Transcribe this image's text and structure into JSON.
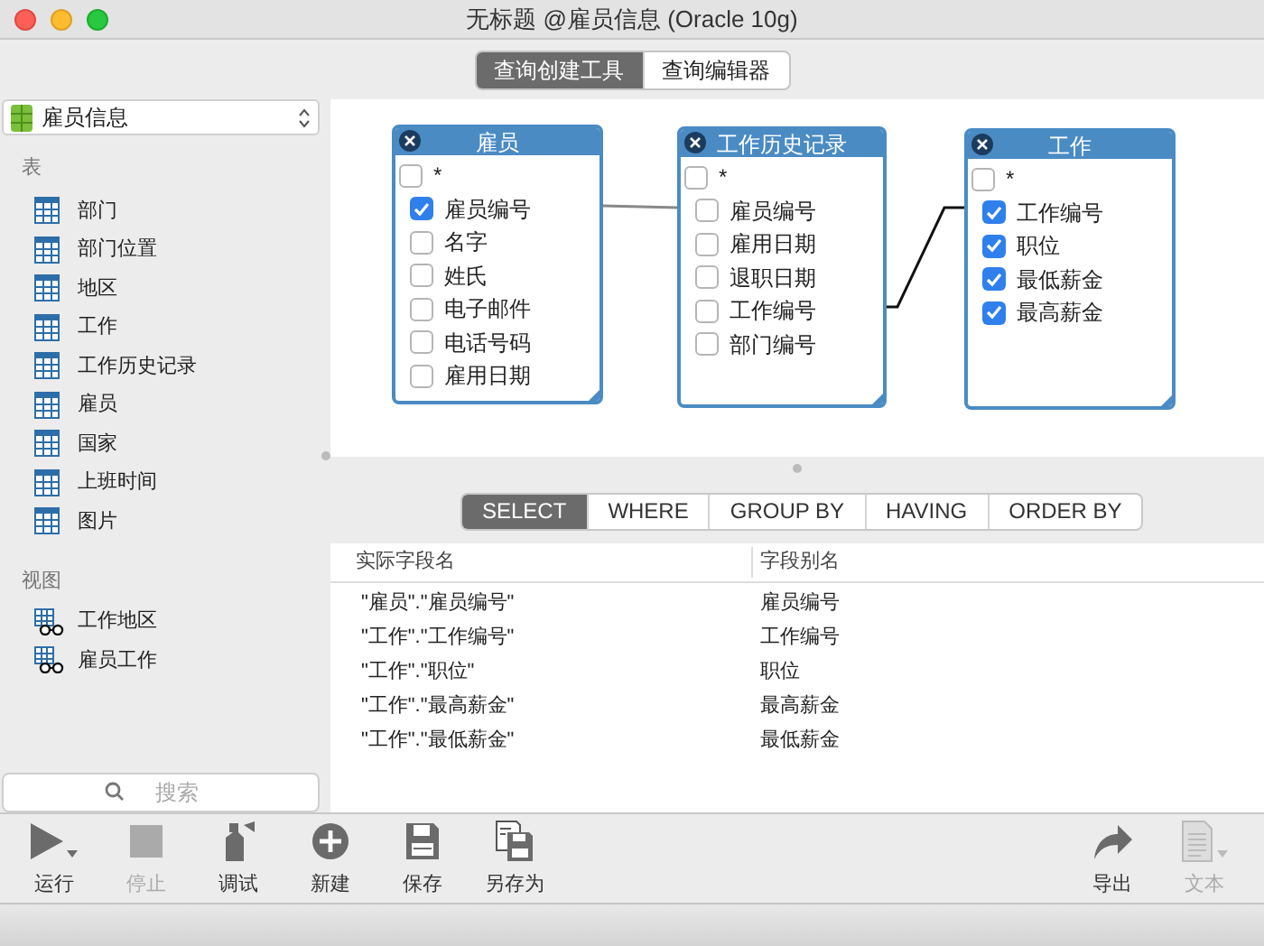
{
  "window": {
    "title": "无标题 @雇员信息 (Oracle 10g)"
  },
  "mode_tabs": [
    {
      "label": "查询创建工具",
      "selected": true
    },
    {
      "label": "查询编辑器",
      "selected": false
    }
  ],
  "sidebar": {
    "database": "雇员信息",
    "sections": [
      {
        "title": "表",
        "items": [
          {
            "label": "部门",
            "kind": "table"
          },
          {
            "label": "部门位置",
            "kind": "table"
          },
          {
            "label": "地区",
            "kind": "table"
          },
          {
            "label": "工作",
            "kind": "table"
          },
          {
            "label": "工作历史记录",
            "kind": "table"
          },
          {
            "label": "雇员",
            "kind": "table"
          },
          {
            "label": "国家",
            "kind": "table"
          },
          {
            "label": "上班时间",
            "kind": "table"
          },
          {
            "label": "图片",
            "kind": "table"
          }
        ]
      },
      {
        "title": "视图",
        "items": [
          {
            "label": "工作地区",
            "kind": "view"
          },
          {
            "label": "雇员工作",
            "kind": "view"
          }
        ]
      }
    ],
    "search": {
      "placeholder": "搜索"
    }
  },
  "diagram": {
    "tables": [
      {
        "title": "雇员",
        "fields": [
          {
            "label": "*",
            "checked": false
          },
          {
            "label": "雇员编号",
            "checked": true
          },
          {
            "label": "名字",
            "checked": false
          },
          {
            "label": "姓氏",
            "checked": false
          },
          {
            "label": "电子邮件",
            "checked": false
          },
          {
            "label": "电话号码",
            "checked": false
          },
          {
            "label": "雇用日期",
            "checked": false
          }
        ]
      },
      {
        "title": "工作历史记录",
        "fields": [
          {
            "label": "*",
            "checked": false
          },
          {
            "label": "雇员编号",
            "checked": false
          },
          {
            "label": "雇用日期",
            "checked": false
          },
          {
            "label": "退职日期",
            "checked": false
          },
          {
            "label": "工作编号",
            "checked": false
          },
          {
            "label": "部门编号",
            "checked": false
          }
        ]
      },
      {
        "title": "工作",
        "fields": [
          {
            "label": "*",
            "checked": false
          },
          {
            "label": "工作编号",
            "checked": true
          },
          {
            "label": "职位",
            "checked": true
          },
          {
            "label": "最低薪金",
            "checked": true
          },
          {
            "label": "最高薪金",
            "checked": true
          }
        ]
      }
    ]
  },
  "clause_tabs": [
    {
      "label": "SELECT",
      "selected": true
    },
    {
      "label": "WHERE",
      "selected": false
    },
    {
      "label": "GROUP BY",
      "selected": false
    },
    {
      "label": "HAVING",
      "selected": false
    },
    {
      "label": "ORDER BY",
      "selected": false
    }
  ],
  "fields_table": {
    "columns": [
      "实际字段名",
      "字段别名"
    ],
    "rows": [
      [
        "\"雇员\".\"雇员编号\"",
        "雇员编号"
      ],
      [
        "\"工作\".\"工作编号\"",
        "工作编号"
      ],
      [
        "\"工作\".\"职位\"",
        "职位"
      ],
      [
        "\"工作\".\"最高薪金\"",
        "最高薪金"
      ],
      [
        "\"工作\".\"最低薪金\"",
        "最低薪金"
      ]
    ]
  },
  "toolbar": {
    "left": [
      {
        "label": "运行",
        "kind": "run",
        "disabled": false
      },
      {
        "label": "停止",
        "kind": "stop",
        "disabled": true
      },
      {
        "label": "调试",
        "kind": "debug",
        "disabled": false
      },
      {
        "label": "新建",
        "kind": "new",
        "disabled": false
      },
      {
        "label": "保存",
        "kind": "save",
        "disabled": false
      },
      {
        "label": "另存为",
        "kind": "save_as",
        "disabled": false
      }
    ],
    "right": [
      {
        "label": "导出",
        "kind": "export",
        "disabled": false
      },
      {
        "label": "文本",
        "kind": "text",
        "disabled": true
      }
    ]
  }
}
